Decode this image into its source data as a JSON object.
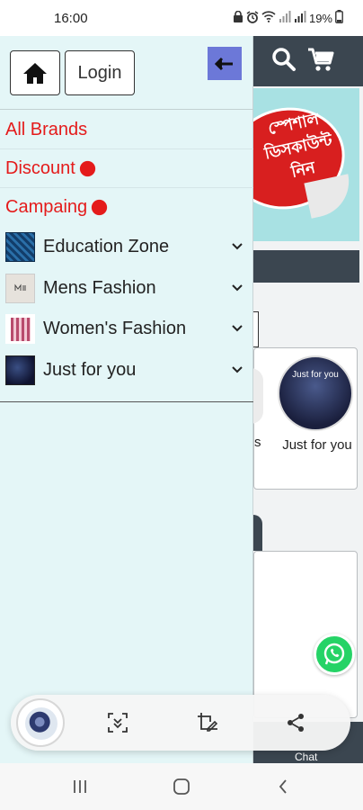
{
  "status_bar": {
    "time": "16:00",
    "battery": "19%",
    "icons": [
      "lock-icon",
      "alarm-icon",
      "wifi-icon",
      "signal-icon",
      "signal-icon",
      "battery-icon"
    ]
  },
  "drawer": {
    "login_label": "Login",
    "red_items": [
      {
        "label": "All Brands",
        "has_dot": false
      },
      {
        "label": "Discount",
        "has_dot": true
      },
      {
        "label": "Campaing",
        "has_dot": true
      }
    ],
    "categories": [
      {
        "label": "Education Zone",
        "icon": "education-thumb"
      },
      {
        "label": "Mens Fashion",
        "icon": "mens-thumb"
      },
      {
        "label": "Women's Fashion",
        "icon": "women-thumb"
      },
      {
        "label": "Just for you",
        "icon": "just-for-you-thumb"
      }
    ]
  },
  "background": {
    "banner_text": "স্পেশাল ডিসকাউন্ট নিন",
    "card_label": "Just for you",
    "card_partial_letter": "s",
    "card_circle_text": "Just for you",
    "chat_label": "Chat"
  },
  "colors": {
    "drawer_bg": "#e4f6f7",
    "accent_red": "#e41b1b",
    "back_button": "#6c78d8",
    "app_header": "#3b4650",
    "whatsapp": "#25d366"
  }
}
